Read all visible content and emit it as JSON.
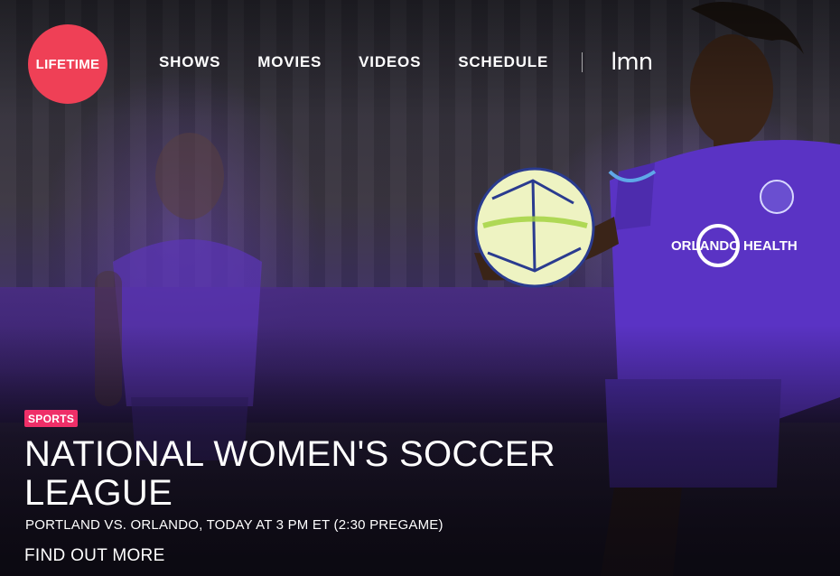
{
  "brand": {
    "logo_text": "LIFETIME",
    "logo_color": "#ef4056",
    "lmn_text": "lmn"
  },
  "nav": {
    "items": [
      "SHOWS",
      "MOVIES",
      "VIDEOS",
      "SCHEDULE"
    ]
  },
  "hero": {
    "category_badge": "SPORTS",
    "category_color": "#ef2f68",
    "title": "NATIONAL WOMEN'S SOCCER LEAGUE",
    "subtitle": "PORTLAND VS. ORLANDO, TODAY AT 3 PM ET (2:30 PREGAME)",
    "cta": "FIND OUT MORE",
    "jersey_text": "ORLANDO HEALTH"
  }
}
